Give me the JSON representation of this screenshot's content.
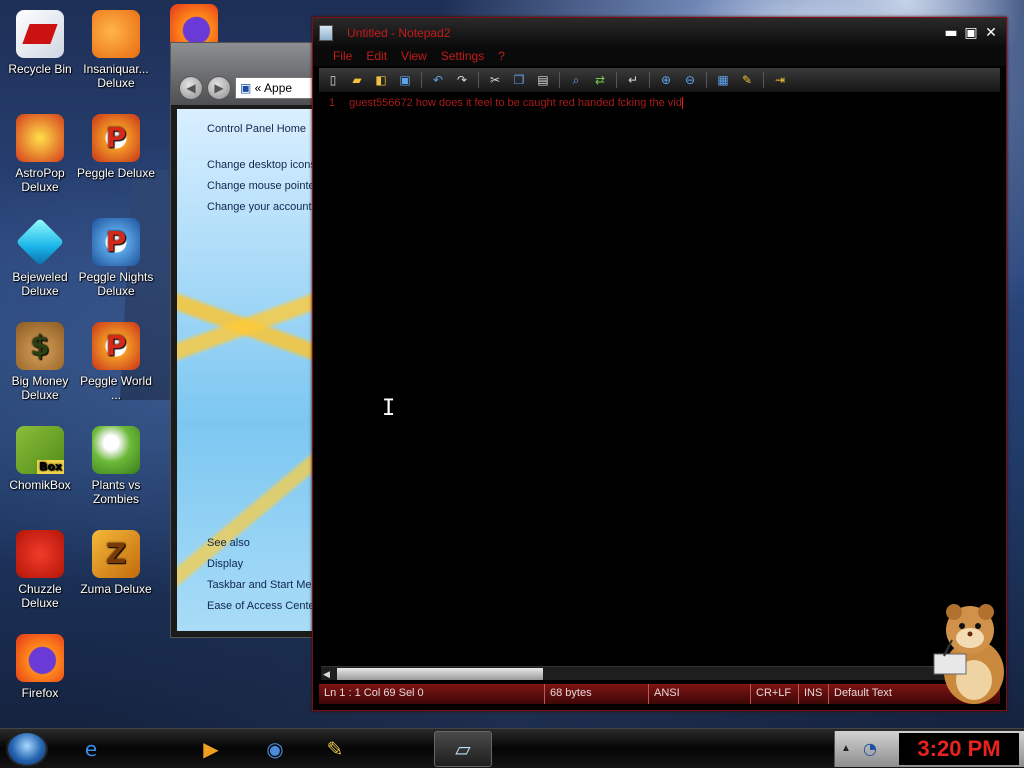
{
  "desktop": {
    "icons": [
      {
        "label": "Recycle Bin",
        "icon": "recycle-bin-icon"
      },
      {
        "label": "Insaniquar... Deluxe",
        "icon": "fish-icon"
      },
      {
        "label": "AstroPop Deluxe",
        "icon": "astropop-icon"
      },
      {
        "label": "Peggle Deluxe",
        "icon": "peggle-icon"
      },
      {
        "label": "Bejeweled Deluxe",
        "icon": "gem-icon"
      },
      {
        "label": "Peggle Nights Deluxe",
        "icon": "peggle-nights-icon"
      },
      {
        "label": "Big Money Deluxe",
        "icon": "money-bag-icon"
      },
      {
        "label": "Peggle World ...",
        "icon": "peggle-world-icon"
      },
      {
        "label": "ChomikBox",
        "icon": "chomikbox-icon"
      },
      {
        "label": "Plants vs Zombies",
        "icon": "plants-vs-zombies-icon"
      },
      {
        "label": "Chuzzle Deluxe",
        "icon": "chuzzle-icon"
      },
      {
        "label": "Zuma Deluxe",
        "icon": "zuma-icon"
      },
      {
        "label": "Firefox",
        "icon": "firefox-icon"
      }
    ]
  },
  "control_panel": {
    "address": "« Appe",
    "links": [
      "Control Panel Home",
      "Change desktop icons",
      "Change mouse pointe",
      "Change your account"
    ],
    "see_also_heading": "See also",
    "see_also": [
      "Display",
      "Taskbar and Start Me",
      "Ease of Access Cente"
    ]
  },
  "notepad": {
    "title": "Untitled - Notepad2",
    "menu": [
      "File",
      "Edit",
      "View",
      "Settings",
      "?"
    ],
    "toolbar_icons": [
      "new-file-icon",
      "open-folder-icon",
      "browse-icon",
      "save-icon",
      "undo-icon",
      "redo-icon",
      "cut-icon",
      "copy-icon",
      "paste-icon",
      "find-icon",
      "replace-icon",
      "word-wrap-icon",
      "zoom-in-icon",
      "zoom-out-icon",
      "scheme-icon",
      "customize-icon",
      "exit-icon"
    ],
    "line_number": "1",
    "content": "guest556672 how does it feel to be caught red handed fcking the vid",
    "status": {
      "position": "Ln 1 : 1   Col 69   Sel 0",
      "size": "68 bytes",
      "encoding": "ANSI",
      "line_endings": "CR+LF",
      "mode": "INS",
      "scheme": "Default Text"
    }
  },
  "taskbar": {
    "apps": [
      "internet-explorer-icon",
      "media-player-icon",
      "globe-icon",
      "paint-icon",
      "notepad-icon"
    ],
    "clock": "3:20 PM"
  },
  "colors": {
    "notepad_accent": "#c41c1c",
    "clock_text": "#e8231d"
  }
}
